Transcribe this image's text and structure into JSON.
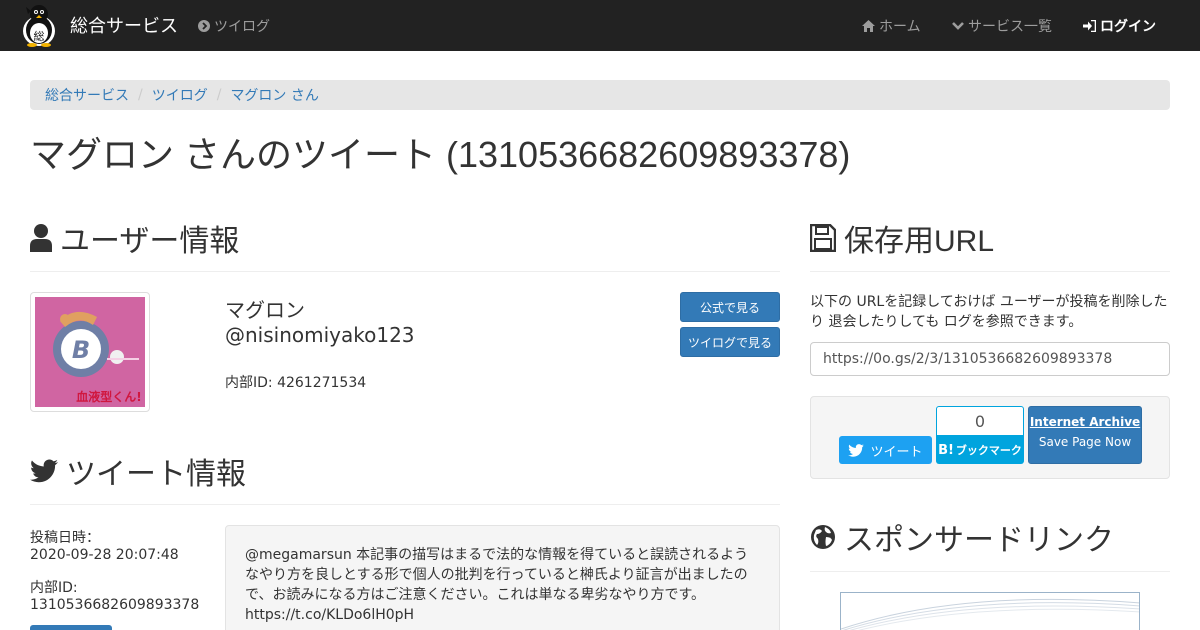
{
  "navbar": {
    "brand": "総合サービス",
    "twilog": "ツイログ",
    "home": "ホーム",
    "services": "サービス一覧",
    "login": "ログイン"
  },
  "breadcrumb": [
    "総合サービス",
    "ツイログ",
    "マグロン さん"
  ],
  "page_title": "マグロン さんのツイート (1310536682609893378)",
  "user_section": {
    "heading": "ユーザー情報",
    "display_name": "マグロン",
    "handle": "@nisinomiyako123",
    "internal_id": "内部ID: 4261271534",
    "avatar_text": "血液型くん!",
    "btn_official": "公式で見る",
    "btn_twilog": "ツイログで見る"
  },
  "tweet_section": {
    "heading": "ツイート情報",
    "posted_label": "投稿日時：",
    "posted_value": "2020-09-28 20:07:48",
    "id_label": "内部ID:",
    "id_value": "1310536682609893378",
    "text": "@megamarsun 本記事の描写はまるで法的な情報を得ていると誤読されるようなやり方を良しとする形で個人の批判を行っていると榊氏より証言が出ましたので、お読みになる方はご注意ください。これは単なる卑劣なやり方です。 https://t.co/KLDo6lH0pH"
  },
  "archive_section": {
    "heading": "保存用URL",
    "description": "以下の URLを記録しておけば ユーザーが投稿を削除したり 退会したりしても ログを参照できます。",
    "url": "https://0o.gs/2/3/1310536682609893378",
    "tweet_button": "ツイート",
    "hatena_count": "0",
    "hatena_label": "ブックマーク",
    "hatena_b": "B!",
    "ia_title": "Internet Archive",
    "ia_sub": "Save Page Now"
  },
  "sponsor_section": {
    "heading": "スポンサードリンク"
  },
  "colors": {
    "navbar_bg": "#222222",
    "primary": "#337ab7",
    "twitter": "#1da1f2",
    "hatena": "#00a4de",
    "avatar_bg": "#c95a9a"
  }
}
